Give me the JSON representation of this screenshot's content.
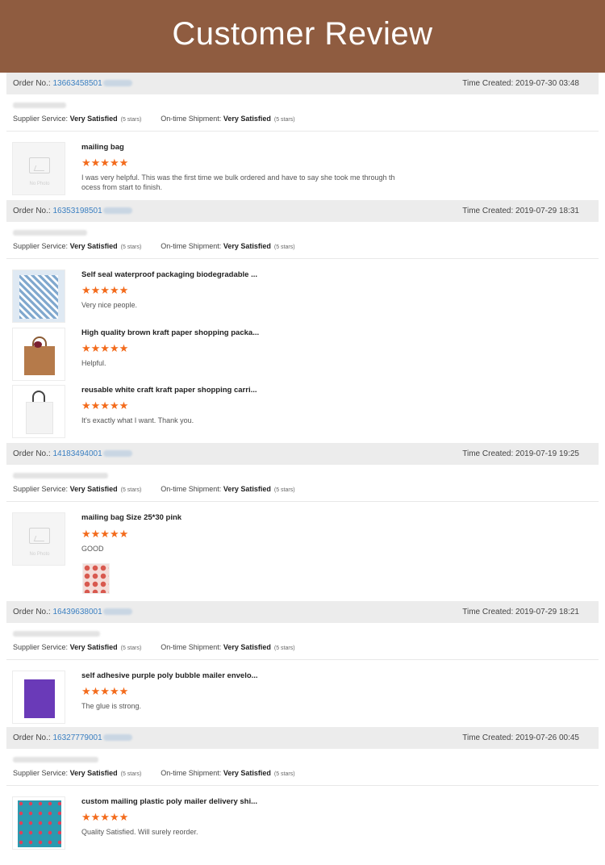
{
  "banner": {
    "title": "Customer Review"
  },
  "labels": {
    "order_no": "Order No.:",
    "time_created": "Time Created:",
    "supplier_service": "Supplier Service:",
    "ontime_shipment": "On-time Shipment:",
    "no_photo": "No Photo"
  },
  "orders": [
    {
      "order_no": "13663458501",
      "time": "2019-07-30 03:48",
      "supplier_rating": "Very Satisfied",
      "supplier_stars": "(5 stars)",
      "shipment_rating": "Very Satisfied",
      "shipment_stars": "(5 stars)",
      "items": [
        {
          "title": "mailing bag",
          "stars": "★★★★★",
          "comment_1": "I  was very helpful. This was the first time we bulk ordered and have to say she took me through th",
          "comment_2": "ocess from start to finish."
        }
      ]
    },
    {
      "order_no": "16353198501",
      "time": "2019-07-29 18:31",
      "supplier_rating": "Very Satisfied",
      "supplier_stars": "(5 stars)",
      "shipment_rating": "Very Satisfied",
      "shipment_stars": "(5 stars)",
      "items": [
        {
          "title": "Self seal waterproof packaging biodegradable ...",
          "stars": "★★★★★",
          "comment": "Very nice people."
        },
        {
          "title": "High quality brown kraft paper shopping packa...",
          "stars": "★★★★★",
          "comment": "Helpful."
        },
        {
          "title": "reusable white craft kraft paper shopping carri...",
          "stars": "★★★★★",
          "comment": "It's exactly what I want. Thank you."
        }
      ]
    },
    {
      "order_no": "14183494001",
      "time": "2019-07-19 19:25",
      "supplier_rating": "Very Satisfied",
      "supplier_stars": "(5 stars)",
      "shipment_rating": "Very Satisfied",
      "shipment_stars": "(5 stars)",
      "items": [
        {
          "title": "mailing bag Size 25*30 pink",
          "stars": "★★★★★",
          "comment": "GOOD"
        }
      ]
    },
    {
      "order_no": "16439638001",
      "time": "2019-07-29 18:21",
      "supplier_rating": "Very Satisfied",
      "supplier_stars": "(5 stars)",
      "shipment_rating": "Very Satisfied",
      "shipment_stars": "(5 stars)",
      "items": [
        {
          "title": "self adhesive purple poly bubble mailer envelo...",
          "stars": "★★★★★",
          "comment": "The glue is strong."
        }
      ]
    },
    {
      "order_no": "16327779001",
      "time": "2019-07-26 00:45",
      "supplier_rating": "Very Satisfied",
      "supplier_stars": "(5 stars)",
      "shipment_rating": "Very Satisfied",
      "shipment_stars": "(5 stars)",
      "items": [
        {
          "title": "custom mailing plastic poly mailer delivery shi...",
          "stars": "★★★★★",
          "comment": "Quality Satisfied. Will surely reorder."
        }
      ]
    }
  ],
  "colors": {
    "banner": "#8f5c40",
    "stars": "#f36b1c",
    "order_link": "#3a7fc1"
  }
}
